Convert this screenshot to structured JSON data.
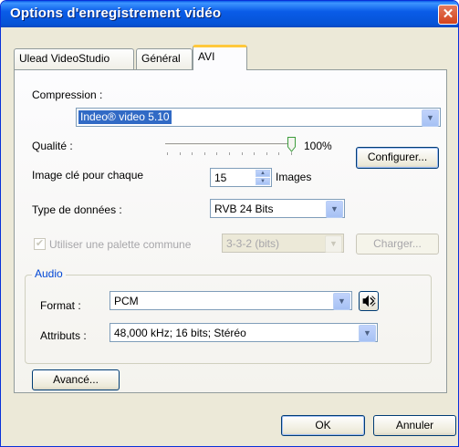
{
  "window": {
    "title": "Options d'enregistrement vidéo"
  },
  "tabs": [
    {
      "label": "Ulead VideoStudio"
    },
    {
      "label": "Général"
    },
    {
      "label": "AVI"
    }
  ],
  "compression": {
    "label": "Compression :",
    "value": "Indeo® video 5.10"
  },
  "quality": {
    "label": "Qualité :",
    "value_text": "100%",
    "level": 1.0,
    "configure_label": "Configurer..."
  },
  "keyframe": {
    "label": "Image clé pour chaque",
    "value": "15",
    "unit": "Images"
  },
  "datatype": {
    "label": "Type de données :",
    "value": "RVB 24 Bits"
  },
  "palette": {
    "checkbox_label": "Utiliser une palette commune",
    "checked": true,
    "value": "3-3-2 (bits)",
    "load_label": "Charger..."
  },
  "audio": {
    "group_label": "Audio",
    "format_label": "Format :",
    "format_value": "PCM",
    "attributes_label": "Attributs :",
    "attributes_value": "48,000 kHz; 16 bits; Stéréo"
  },
  "advanced_label": "Avancé...",
  "footer": {
    "ok_label": "OK",
    "cancel_label": "Annuler"
  },
  "icons": {
    "close": "close-icon",
    "dropdown": "chevron-down-icon",
    "speaker": "speaker-icon"
  }
}
